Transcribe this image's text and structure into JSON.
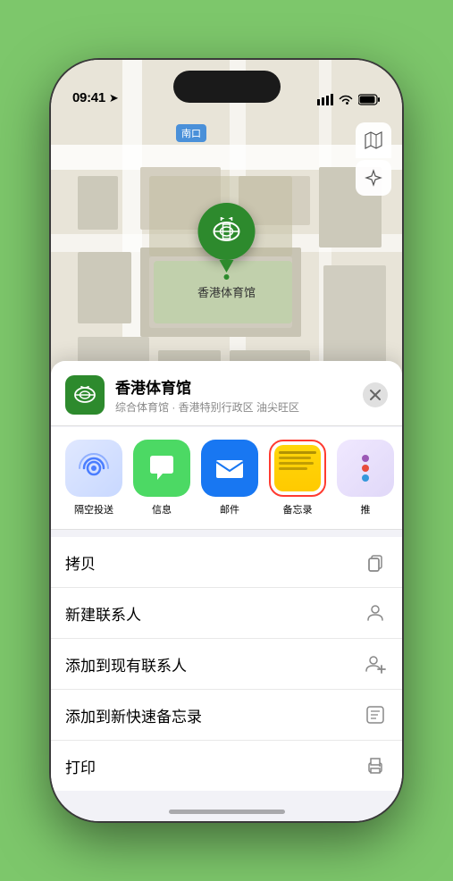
{
  "status_bar": {
    "time": "09:41",
    "location_arrow": true
  },
  "map": {
    "label_text": "南口",
    "controls": {
      "map_icon": "🗺",
      "location_icon": "↖"
    }
  },
  "venue": {
    "name": "香港体育馆",
    "description": "综合体育馆 · 香港特别行政区 油尖旺区",
    "pin_label": "香港体育馆"
  },
  "share_items": [
    {
      "id": "airdrop",
      "label": "隔空投送",
      "style": "airdrop"
    },
    {
      "id": "messages",
      "label": "信息",
      "style": "messages"
    },
    {
      "id": "mail",
      "label": "邮件",
      "style": "mail"
    },
    {
      "id": "notes",
      "label": "备忘录",
      "style": "notes",
      "selected": true
    },
    {
      "id": "more",
      "label": "推",
      "style": "more"
    }
  ],
  "action_rows": [
    {
      "id": "copy",
      "label": "拷贝",
      "icon": "copy"
    },
    {
      "id": "new-contact",
      "label": "新建联系人",
      "icon": "person"
    },
    {
      "id": "add-existing",
      "label": "添加到现有联系人",
      "icon": "person-add"
    },
    {
      "id": "quick-notes",
      "label": "添加到新快速备忘录",
      "icon": "notes"
    },
    {
      "id": "print",
      "label": "打印",
      "icon": "print"
    }
  ],
  "close_btn_label": "×"
}
